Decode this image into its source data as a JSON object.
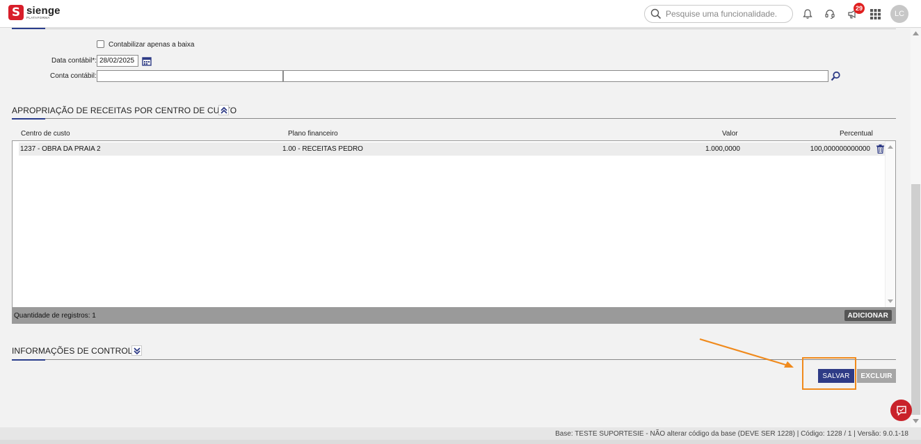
{
  "header": {
    "logo_name": "sienge",
    "logo_sub": "PLATAFORMA",
    "search_placeholder": "Pesquise uma funcionalidade.",
    "notification_badge": "29",
    "avatar_initials": "LC"
  },
  "form": {
    "checkbox_label": "Contabilizar apenas a baixa",
    "data_contabil_label": "Data contábil*:",
    "data_contabil_value": "28/02/2025",
    "conta_contabil_label": "Conta contábil:"
  },
  "apropriacao": {
    "title": "APROPRIAÇÃO DE RECEITAS POR CENTRO DE CUSTO",
    "columns": [
      "Centro de custo",
      "Plano financeiro",
      "Valor",
      "Percentual"
    ],
    "rows": [
      {
        "centro": "1237 - OBRA DA PRAIA 2",
        "plano": "1.00 - RECEITAS PEDRO",
        "valor": "1.000,0000",
        "percentual": "100,000000000000"
      }
    ],
    "count_label": "Quantidade de registros: 1",
    "add_label": "ADICIONAR"
  },
  "controle": {
    "title": "INFORMAÇÕES DE CONTROLE"
  },
  "actions": {
    "save_label": "SALVAR",
    "delete_label": "EXCLUIR"
  },
  "footer": {
    "text": "Base: TESTE SUPORTESIE - NÃO alterar código da base (DEVE SER 1228) | Código: 1228 / 1 | Versão: 9.0.1-18"
  },
  "colors": {
    "brand": "#d81e2a",
    "primary": "#2e3b86",
    "annotation": "#f08a1c"
  }
}
